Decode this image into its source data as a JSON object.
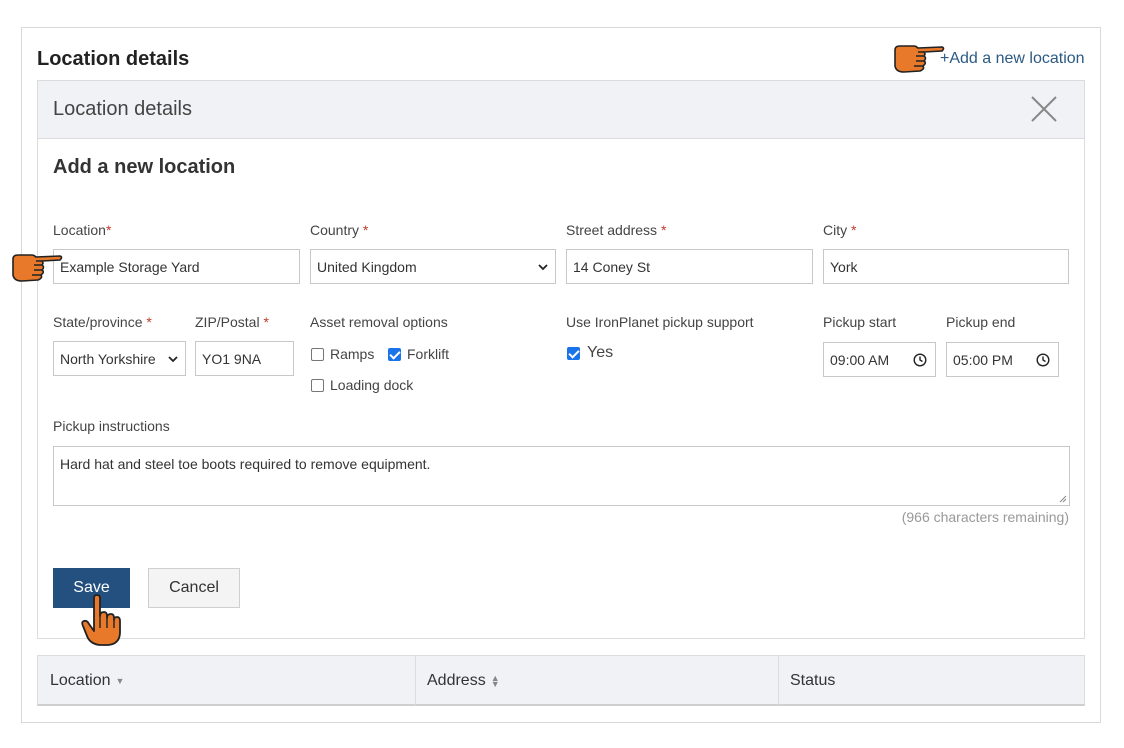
{
  "page": {
    "section_title": "Location details",
    "add_link": "+Add a new location"
  },
  "panel": {
    "title": "Location details",
    "form_title": "Add a new location"
  },
  "form": {
    "location": {
      "label": "Location",
      "req": "*",
      "value": "Example Storage Yard"
    },
    "country": {
      "label": "Country",
      "req": "*",
      "value": "United Kingdom"
    },
    "street": {
      "label": "Street address",
      "req": "*",
      "value": "14 Coney St"
    },
    "city": {
      "label": "City",
      "req": "*",
      "value": "York"
    },
    "state": {
      "label": "State/province",
      "req": "*",
      "value": "North Yorkshire"
    },
    "zip": {
      "label": "ZIP/Postal",
      "req": "*",
      "value": "YO1 9NA"
    },
    "asset_removal": {
      "label": "Asset removal options",
      "options": [
        {
          "label": "Ramps",
          "checked": false
        },
        {
          "label": "Forklift",
          "checked": true
        },
        {
          "label": "Loading dock",
          "checked": false
        }
      ]
    },
    "pickup_support": {
      "label": "Use IronPlanet pickup support",
      "option": "Yes",
      "checked": true
    },
    "pickup_start": {
      "label": "Pickup start",
      "value": "09:00 AM"
    },
    "pickup_end": {
      "label": "Pickup end",
      "value": "05:00 PM"
    },
    "instructions": {
      "label": "Pickup instructions",
      "value": "Hard hat and steel toe boots required to remove equipment.",
      "remaining": "(966 characters remaining)"
    },
    "save_label": "Save",
    "cancel_label": "Cancel"
  },
  "table": {
    "columns": [
      "Location",
      "Address",
      "Status"
    ]
  },
  "colors": {
    "primary": "#23507f",
    "link": "#2b5a84",
    "pointer_hand": "#e8782a",
    "required": "#c0392b"
  },
  "icons": [
    "pointing-hand-icon",
    "close-icon",
    "chevron-down-icon",
    "clock-icon",
    "cursor-hand-icon",
    "sort-icon"
  ]
}
